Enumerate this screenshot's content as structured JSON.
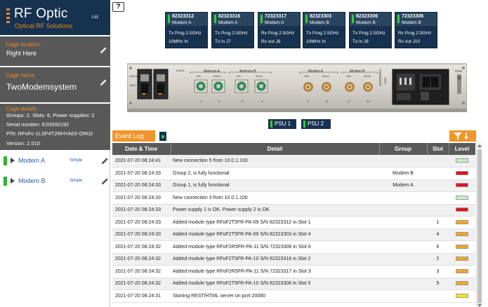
{
  "logo": {
    "title": "RF Optic",
    "ltd": "Ltd.",
    "subtitle": "Optical RF Solutions"
  },
  "cage_location": {
    "label": "Cage location",
    "value": "Right Here"
  },
  "cage_name": {
    "label": "Cage name",
    "value": "TwoModemsystem"
  },
  "cage_details": {
    "label": "Cage details",
    "lines": [
      "Groups: 2, Slots: 6, Power supplies: 2",
      "Serial number: E20000192",
      "P/N: RFoFc-1LSF4T2RHYA02-OR02",
      "Version: 2.010"
    ]
  },
  "modems": [
    {
      "name": "Modem A",
      "mode": "Simple"
    },
    {
      "name": "Modem B",
      "mode": "Simple"
    }
  ],
  "help": {
    "label": "?"
  },
  "modules": [
    {
      "serial": "82323312",
      "modem": "Modem A",
      "line1": "Tx Prog 2.5GHz",
      "line2": "10MHz In"
    },
    {
      "serial": "82323316",
      "modem": "Modem A",
      "line1": "Tx Prog 2.5GHz",
      "line2": "Tx in J7"
    },
    {
      "serial": "72323317",
      "modem": "Modem A",
      "line1": "Rx Prog 2.5GHz",
      "line2": "Rx out J8"
    },
    {
      "serial": "82323303",
      "modem": "Modem B",
      "line1": "Tx Prog 2.5GHz",
      "line2": "10MHz In"
    },
    {
      "serial": "82323306",
      "modem": "Modem B",
      "line1": "Tx Prog 2.5GHz",
      "line2": "Tx in J9"
    },
    {
      "serial": "72323306",
      "modem": "Modem B",
      "line1": "Rx Prog 2.5GHz",
      "line2": "Rx out J10"
    }
  ],
  "chassis": {
    "ports_left": [
      "LAN A",
      "LAN B",
      "MAC"
    ],
    "antenna_a": "Antenna A",
    "antenna_b": "Antenna B",
    "modem_a": "Modem A",
    "modem_b": "Modem B",
    "port_sub": [
      "Tx/in",
      "Rx/out"
    ],
    "port_nums": [
      "J1",
      "J2",
      "J3",
      "J4",
      "J7",
      "J8",
      "J9",
      "J10"
    ],
    "power_label": "115/230VAC",
    "power_sub": "PWR",
    "gnd": "GND"
  },
  "psus": [
    {
      "label": "PSU 1"
    },
    {
      "label": "PSU 2"
    }
  ],
  "event_log": {
    "button_label": "Event Log",
    "columns": [
      "Date & Time",
      "Detail",
      "Group",
      "Slot",
      "Level"
    ],
    "rows": [
      {
        "date": "2021-07-20 08:24:41",
        "detail": "New connection 5 from 10.0.1.100",
        "group": "",
        "slot": "",
        "level_color": "#c7eec7"
      },
      {
        "date": "2021-07-20 08:24:33",
        "detail": "Group 2, is fully functional",
        "group": "Modem B",
        "slot": "",
        "level_color": "#e3121b"
      },
      {
        "date": "2021-07-20 08:24:33",
        "detail": "Group 1, is fully functional",
        "group": "Modem A",
        "slot": "",
        "level_color": "#e3121b"
      },
      {
        "date": "2021-07-20 08:24:33",
        "detail": "New connection 3 from 10.0.1.100",
        "group": "",
        "slot": "",
        "level_color": "#c7eec7"
      },
      {
        "date": "2021-07-20 08:24:33",
        "detail": "Power supply 1 is OK, Power supply 2 is OK",
        "group": "",
        "slot": "",
        "level_color": "#e3121b"
      },
      {
        "date": "2021-07-20 08:24:33",
        "detail": "Added module type RFoF2T5FR-PA-09 S/N 82323312 in Slot 1",
        "group": "",
        "slot": "1",
        "level_color": "#f5a623"
      },
      {
        "date": "2021-07-20 08:24:33",
        "detail": "Added module type RFoF2T5FR-PA-09 S/N 82323303 in Slot 4",
        "group": "",
        "slot": "4",
        "level_color": "#f5a623"
      },
      {
        "date": "2021-07-20 08:24:32",
        "detail": "Added module type RFoF2R5FR-PA-11 S/N 72323306 in Slot 6",
        "group": "",
        "slot": "6",
        "level_color": "#f5a623"
      },
      {
        "date": "2021-07-20 08:24:32",
        "detail": "Added module type RFoF2T5FR-PA-10 S/N 82323316 in Slot 2",
        "group": "",
        "slot": "2",
        "level_color": "#f5a623"
      },
      {
        "date": "2021-07-20 08:24:32",
        "detail": "Added module type RFoF2R5FR-PA-11 S/N 72323317 in Slot 3",
        "group": "",
        "slot": "3",
        "level_color": "#f5a623"
      },
      {
        "date": "2021-07-20 08:24:32",
        "detail": "Added module type RFoF2T5FR-PA-10 S/N 82323306 in Slot 5",
        "group": "",
        "slot": "5",
        "level_color": "#f5a623"
      },
      {
        "date": "2021-07-20 08:24:31",
        "detail": "Starting REST/HTML server on port 20080",
        "group": "",
        "slot": "",
        "level_color": "#f5e623"
      }
    ]
  },
  "icons": {
    "edit": "pencil-icon",
    "filter": "filter-sort-icon",
    "expand": "triangle-right-icon"
  },
  "colors": {
    "brand_navy": "#17324f",
    "accent_orange": "#f0962a",
    "ok_green": "#2fd32f",
    "panel_gray": "#585858"
  }
}
